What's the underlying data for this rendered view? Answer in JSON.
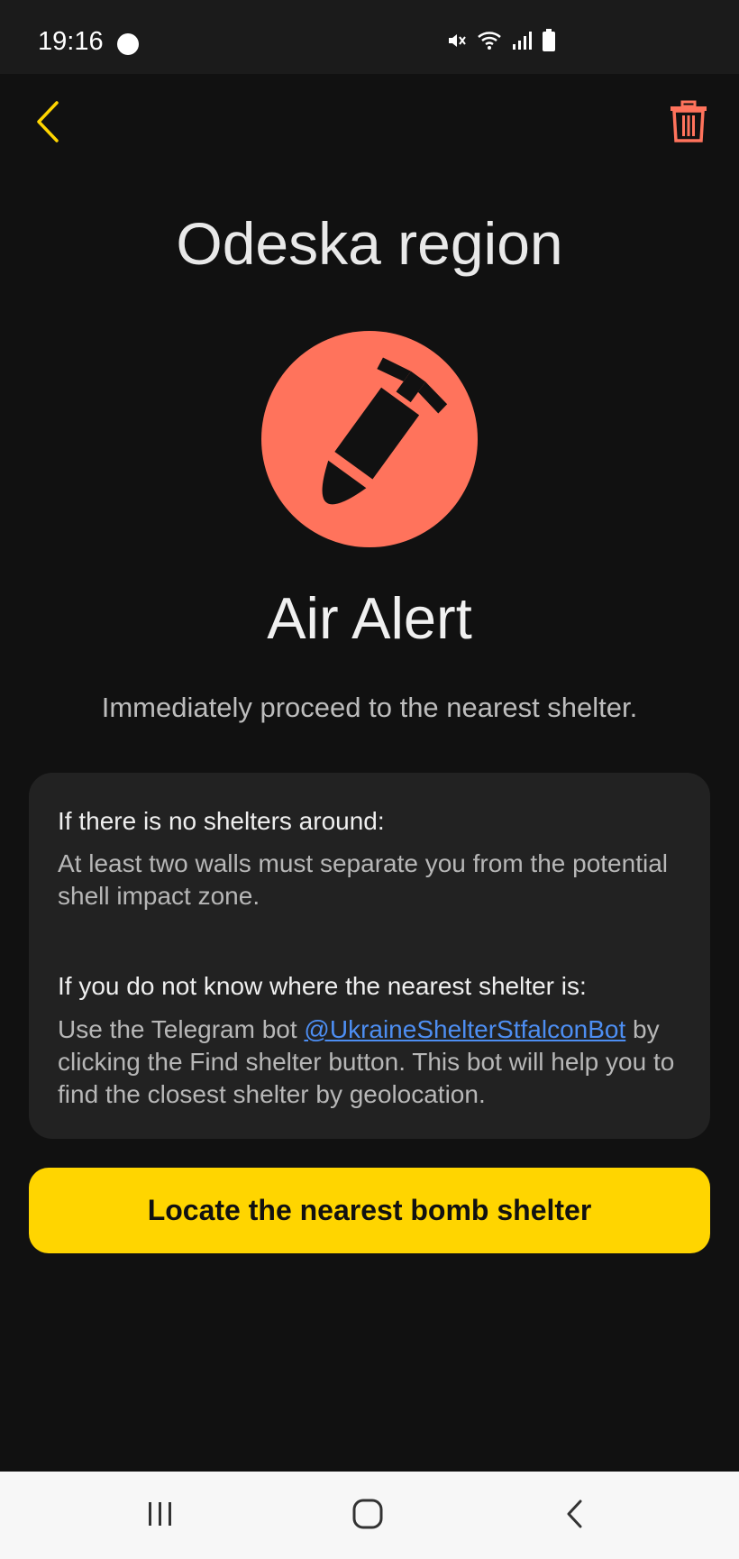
{
  "status_bar": {
    "time": "19:16",
    "icons": [
      "mute-icon",
      "wifi-icon",
      "signal-icon",
      "battery-icon"
    ]
  },
  "header": {
    "back_icon": "chevron-left-icon",
    "delete_icon": "trash-icon"
  },
  "region": {
    "title": "Odeska region"
  },
  "alert": {
    "icon": "bomb-icon",
    "title": "Air Alert",
    "subtitle": "Immediately proceed to the nearest shelter."
  },
  "info_card": {
    "no_shelter_heading": "If there is no shelters around:",
    "no_shelter_text": "At least two walls must separate you from the potential shell impact zone.",
    "unknown_heading": "If you do not know where the nearest shelter is:",
    "unknown_text_prefix": "Use the Telegram bot ",
    "bot_link": "@UkraineShelterStfalconBot",
    "unknown_text_suffix": " by clicking the Find shelter button. This bot will help you to find the closest shelter by geolocation."
  },
  "actions": {
    "locate_label": "Locate the nearest bomb shelter"
  },
  "nav_bar": {
    "items": [
      "recent-apps-icon",
      "home-icon",
      "back-icon"
    ]
  },
  "colors": {
    "background": "#111111",
    "card": "#222222",
    "accent_yellow": "#ffd500",
    "alert_red": "#ff735c",
    "link_blue": "#4d8ef2"
  }
}
